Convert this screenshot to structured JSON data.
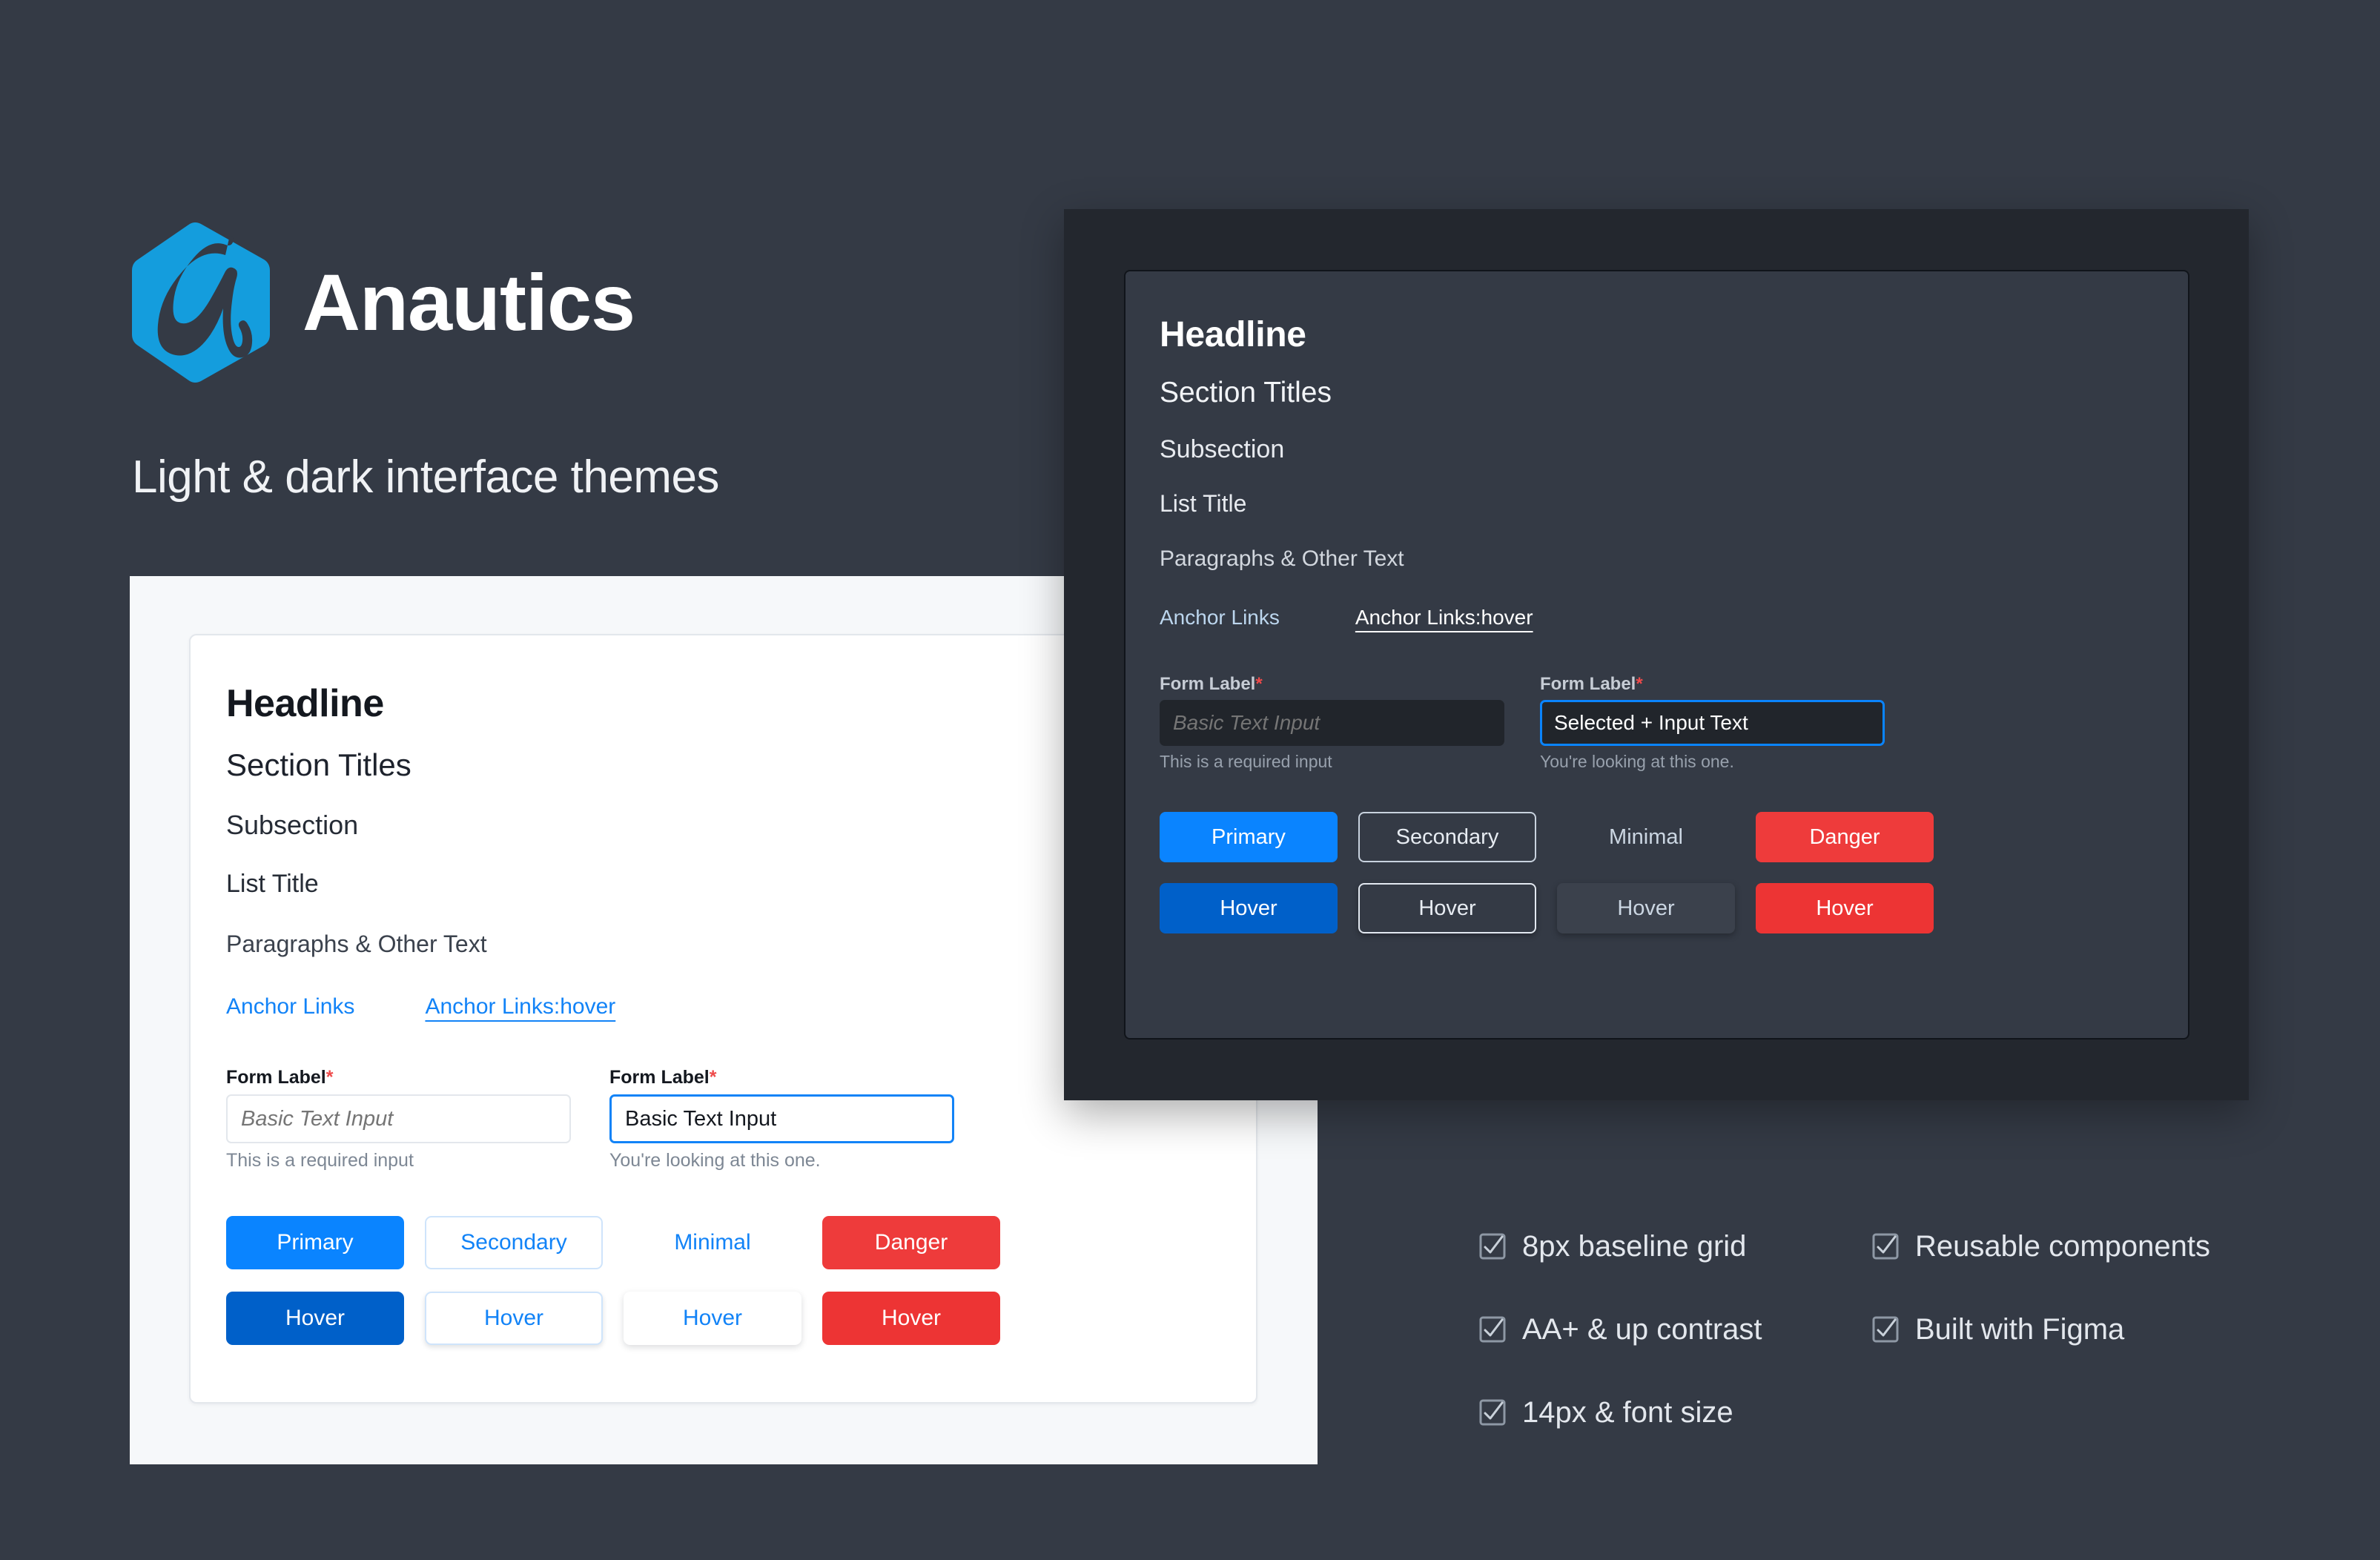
{
  "brand": {
    "name": "Anautics",
    "tagline": "Light & dark interface themes",
    "logo_icon": "anautics-hexagon-logo-icon",
    "logo_color": "#149ddd"
  },
  "theme_colors": {
    "page_background": "#343a45",
    "light_surface": "#f6f8fa",
    "light_card": "#ffffff",
    "dark_surface": "#23272e",
    "dark_card": "#343a45",
    "primary": "#0a84ff",
    "primary_hover": "#0060c9",
    "danger": "#ee3b3b",
    "link": "#1283f7",
    "required_asterisk": "#ee4a4a"
  },
  "light_panel": {
    "headline": "Headline",
    "section_title": "Section Titles",
    "subsection": "Subsection",
    "list_title": "List Title",
    "paragraph": "Paragraphs & Other Text",
    "anchors": {
      "normal": "Anchor Links",
      "hover": "Anchor Links:hover"
    },
    "fields": [
      {
        "label": "Form Label",
        "required_mark": "*",
        "value": "",
        "placeholder": "Basic Text Input",
        "help": "This is a required input",
        "state": "idle"
      },
      {
        "label": "Form Label",
        "required_mark": "*",
        "value": "Basic Text Input",
        "placeholder": "Basic Text Input",
        "help": "You're looking at this one.",
        "state": "focused"
      }
    ],
    "buttons": {
      "default_row": [
        "Primary",
        "Secondary",
        "Minimal",
        "Danger"
      ],
      "hover_row": [
        "Hover",
        "Hover",
        "Hover",
        "Hover"
      ]
    }
  },
  "dark_panel": {
    "headline": "Headline",
    "section_title": "Section Titles",
    "subsection": "Subsection",
    "list_title": "List Title",
    "paragraph": "Paragraphs & Other Text",
    "anchors": {
      "normal": "Anchor Links",
      "hover": "Anchor Links:hover"
    },
    "fields": [
      {
        "label": "Form Label",
        "required_mark": "*",
        "value": "",
        "placeholder": "Basic Text Input",
        "help": "This is a required input",
        "state": "idle"
      },
      {
        "label": "Form Label",
        "required_mark": "*",
        "value": "Selected + Input Text",
        "placeholder": "Basic Text Input",
        "help": "You're looking at this one.",
        "state": "focused"
      }
    ],
    "buttons": {
      "default_row": [
        "Primary",
        "Secondary",
        "Minimal",
        "Danger"
      ],
      "hover_row": [
        "Hover",
        "Hover",
        "Hover",
        "Hover"
      ]
    }
  },
  "features": [
    {
      "icon": "checkbox-checked-icon",
      "label": "8px baseline grid"
    },
    {
      "icon": "checkbox-checked-icon",
      "label": "Reusable components"
    },
    {
      "icon": "checkbox-checked-icon",
      "label": "AA+ & up contrast"
    },
    {
      "icon": "checkbox-checked-icon",
      "label": "Built with Figma"
    },
    {
      "icon": "checkbox-checked-icon",
      "label": "14px & font size"
    }
  ]
}
